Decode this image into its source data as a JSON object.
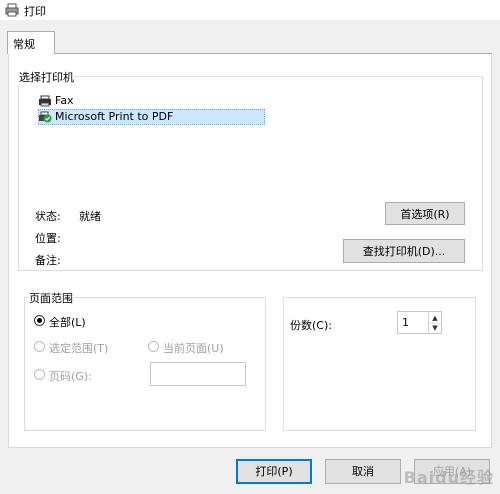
{
  "window": {
    "title": "打印"
  },
  "tabs": [
    {
      "label": "常规"
    }
  ],
  "printer_group": {
    "legend": "选择打印机",
    "printers": [
      {
        "name": "Fax",
        "icon": "fax-printer-icon"
      },
      {
        "name": "Microsoft Print to PDF",
        "icon": "default-printer-icon",
        "selected": true
      }
    ],
    "status_label": "状态:",
    "status_value": "就绪",
    "location_label": "位置:",
    "comment_label": "备注:",
    "preferences_button": "首选项(R)",
    "find_printer_button": "查找打印机(D)..."
  },
  "page_range": {
    "legend": "页面范围",
    "all": "全部(L)",
    "selection": "选定范围(T)",
    "current_page": "当前页面(U)",
    "pages": "页码(G):",
    "pages_value": ""
  },
  "copies": {
    "label": "份数(C):",
    "value": "1"
  },
  "footer": {
    "print_button": "打印(P)",
    "cancel_button": "取消",
    "apply_button": "应用(A)"
  },
  "watermark": {
    "text": "Baidu经验"
  },
  "colors": {
    "accent": "#0078d7",
    "selection": "#cce8ff"
  }
}
